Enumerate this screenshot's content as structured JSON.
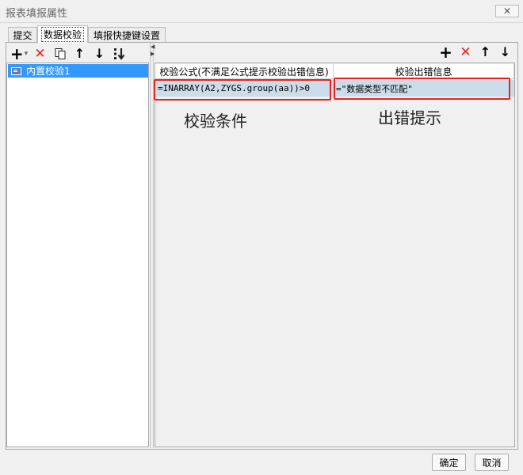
{
  "window": {
    "title": "报表填报属性",
    "close_glyph": "✕"
  },
  "tabs": [
    {
      "label": "提交",
      "active": false
    },
    {
      "label": "数据校验",
      "active": true
    },
    {
      "label": "填报快捷键设置",
      "active": false
    }
  ],
  "left_toolbar": {
    "icons": [
      "add-dropdown-icon",
      "delete-icon",
      "copy-icon",
      "move-up-icon",
      "move-down-icon",
      "sort-icon"
    ],
    "add_glyph": "+",
    "dropdown_glyph": "▾",
    "delete_glyph": "✕",
    "up_glyph": "↑",
    "down_glyph": "↓",
    "sort_glyph": "⇣"
  },
  "left_list": {
    "items": [
      {
        "label": "内置校验1",
        "selected": true
      }
    ]
  },
  "right_toolbar": {
    "add_glyph": "+",
    "delete_glyph": "✕",
    "up_glyph": "↑",
    "down_glyph": "↓"
  },
  "table": {
    "columns": [
      "校验公式(不满足公式提示校验出错信息)",
      "校验出错信息"
    ],
    "rows": [
      {
        "formula": "=INARRAY(A2,ZYGS.group(aa))>0",
        "message": "=\"数据类型不匹配\""
      }
    ]
  },
  "annotations": {
    "condition": "校验条件",
    "error_hint": "出错提示"
  },
  "buttons": {
    "ok": "确定",
    "cancel": "取消"
  },
  "colors": {
    "selection": "#3399ff",
    "row_highlight": "#cbdcea",
    "annotation_box": "#e8231c",
    "delete_red": "#e8231c"
  }
}
